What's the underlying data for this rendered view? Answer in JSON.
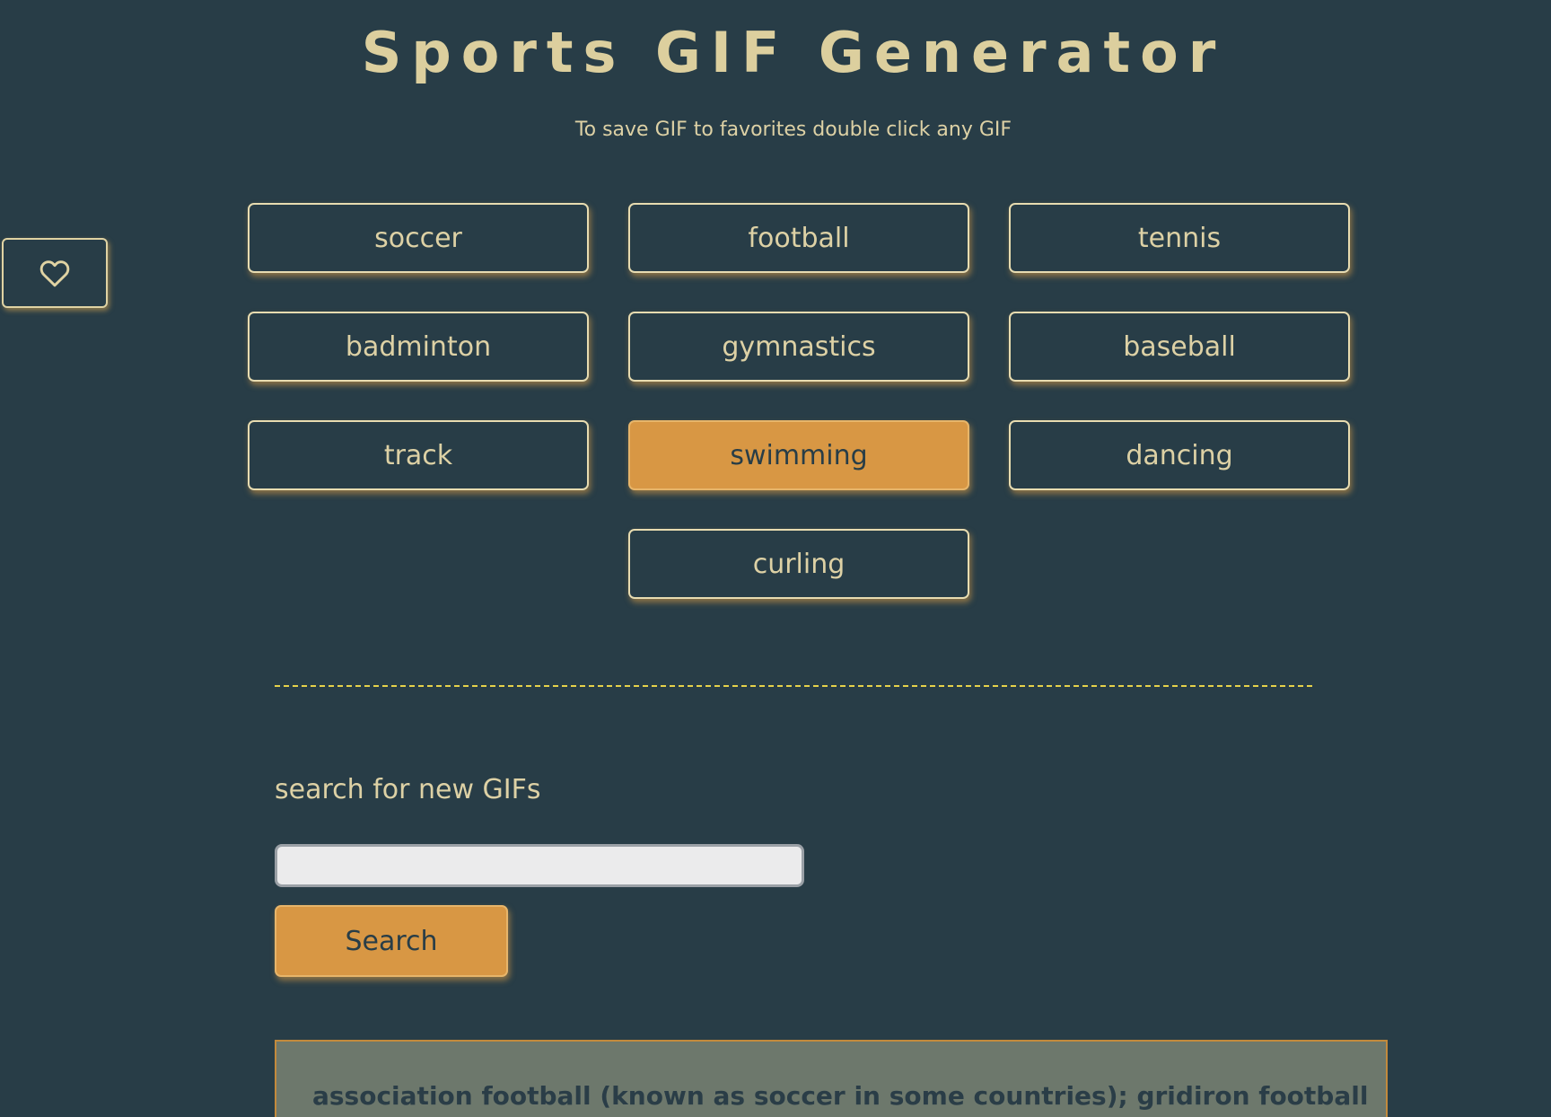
{
  "header": {
    "title": "Sports GIF Generator",
    "subtitle": "To save GIF to favorites double click any GIF"
  },
  "favorites": {
    "icon": "heart-icon"
  },
  "topics": [
    {
      "label": "soccer",
      "active": false
    },
    {
      "label": "football",
      "active": false
    },
    {
      "label": "tennis",
      "active": false
    },
    {
      "label": "badminton",
      "active": false
    },
    {
      "label": "gymnastics",
      "active": false
    },
    {
      "label": "baseball",
      "active": false
    },
    {
      "label": "track",
      "active": false
    },
    {
      "label": "swimming",
      "active": true
    },
    {
      "label": "dancing",
      "active": false
    },
    {
      "label": "curling",
      "active": false
    }
  ],
  "search": {
    "label": "search for new GIFs",
    "value": "",
    "placeholder": "",
    "button_label": "Search"
  },
  "result": {
    "text": "association football (known as soccer in some countries); gridiron football"
  },
  "colors": {
    "background": "#283d47",
    "text": "#ddd1a5",
    "accent": "#d89744",
    "divider": "#e6d24a",
    "panel": "#6d786c"
  }
}
